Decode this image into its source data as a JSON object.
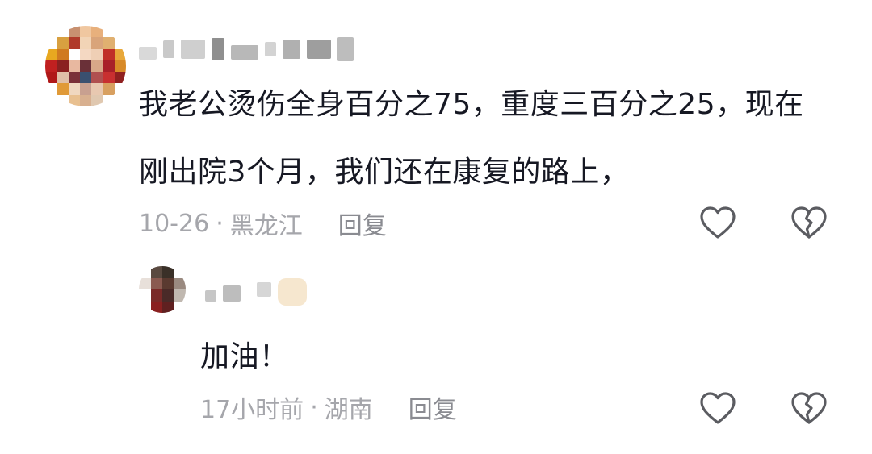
{
  "comments": [
    {
      "text": "我老公烫伤全身百分之75，重度三百分之25，现在刚出院3个月，我们还在康复的路上，",
      "date": "10-26",
      "separator": "·",
      "location": "黑龙江",
      "reply_label": "回复",
      "like_icon": "heart-outline-icon",
      "dislike_icon": "broken-heart-icon"
    },
    {
      "text": "加油！",
      "date": "17小时前",
      "separator": "·",
      "location": "湖南",
      "reply_label": "回复",
      "like_icon": "heart-outline-icon",
      "dislike_icon": "broken-heart-icon"
    }
  ],
  "colors": {
    "text_primary": "#161823",
    "text_meta": "#a5a6ab",
    "icon": "#5b5c61"
  }
}
